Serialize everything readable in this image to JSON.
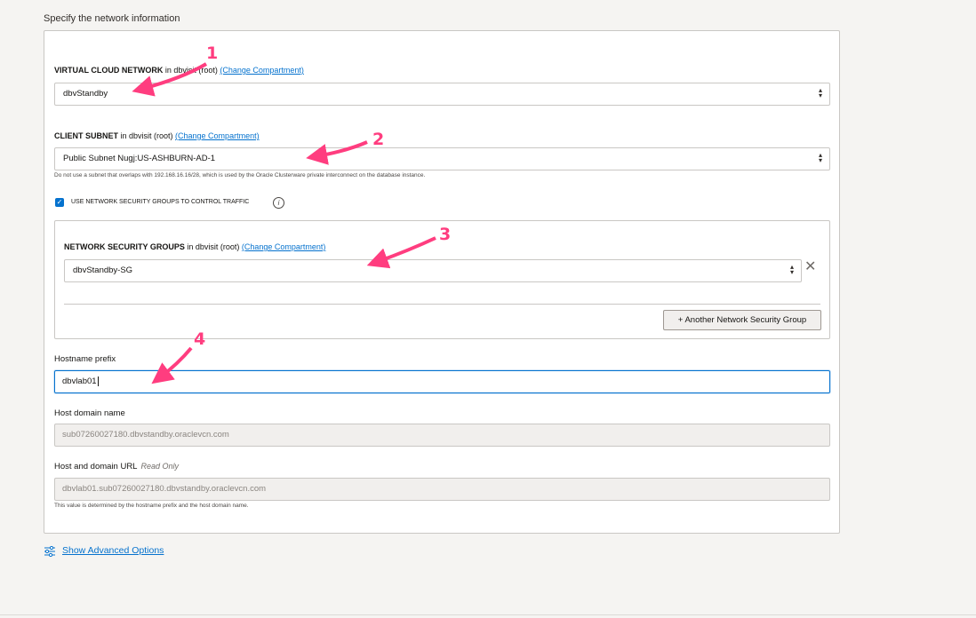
{
  "section_title": "Specify the network information",
  "vcn": {
    "label": "VIRTUAL CLOUD NETWORK",
    "label_suffix": " in dbvisit (root) ",
    "change_link": "(Change Compartment)",
    "value": "dbvStandby"
  },
  "subnet": {
    "label": "CLIENT SUBNET",
    "label_suffix": " in dbvisit (root) ",
    "change_link": "(Change Compartment)",
    "value": "Public Subnet Nugj:US-ASHBURN-AD-1",
    "hint": "Do not use a subnet that overlaps with 192.168.16.16/28, which is used by the Oracle Clusterware private interconnect on the database instance."
  },
  "nsg_checkbox": {
    "label": "USE NETWORK SECURITY GROUPS TO CONTROL TRAFFIC",
    "checked": true
  },
  "nsg": {
    "label": "NETWORK SECURITY GROUPS",
    "label_suffix": " in dbvisit (root) ",
    "change_link": "(Change Compartment)",
    "value": "dbvStandby-SG",
    "add_button": "+ Another Network Security Group"
  },
  "hostname": {
    "label": "Hostname prefix",
    "value": "dbvlab01"
  },
  "host_domain": {
    "label": "Host domain name",
    "value": "sub07260027180.dbvstandby.oraclevcn.com"
  },
  "host_url": {
    "label": "Host and domain URL",
    "read_only": "Read Only",
    "value": "dbvlab01.sub07260027180.dbvstandby.oraclevcn.com",
    "hint": "This value is determined by the hostname prefix and the host domain name."
  },
  "advanced": {
    "link": "Show Advanced Options",
    "icon": "sliders-icon"
  },
  "annotations": [
    "1",
    "2",
    "3",
    "4"
  ],
  "colors": {
    "accent": "#0572ce",
    "annotation": "#ff3d7f"
  }
}
